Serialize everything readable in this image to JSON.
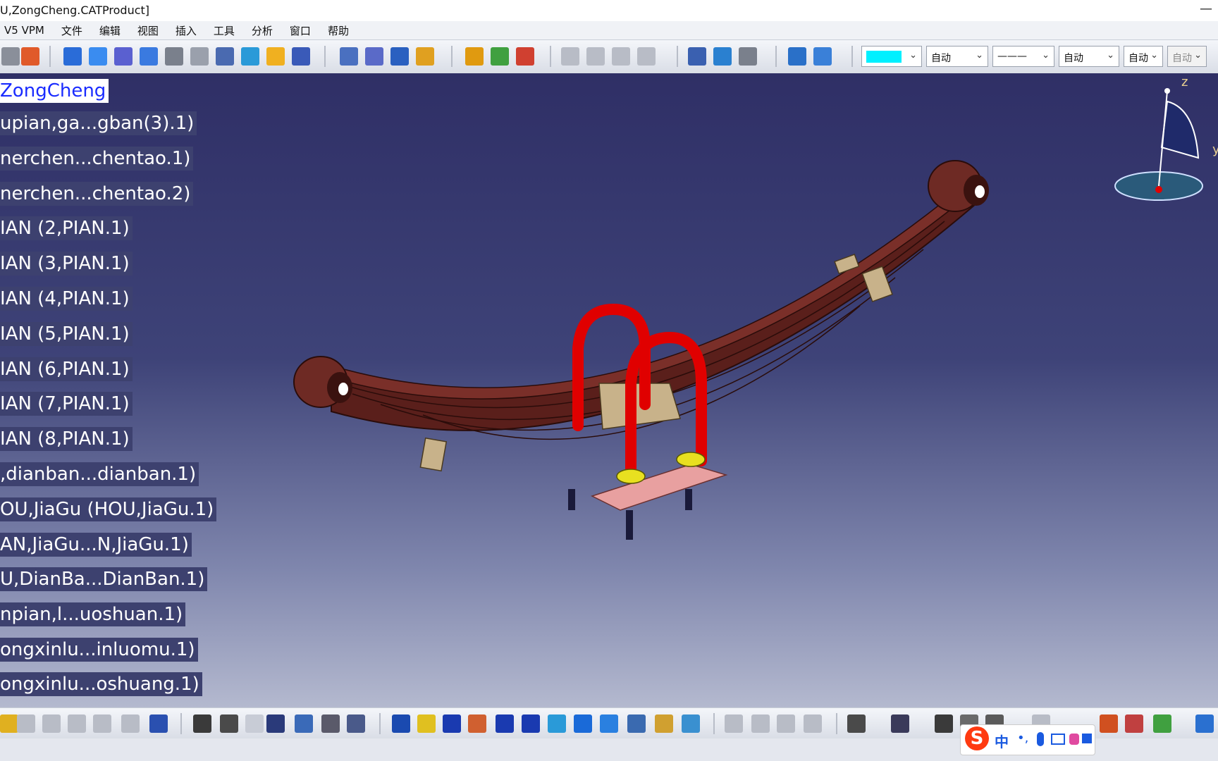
{
  "window": {
    "title": "U,ZongCheng.CATProduct]",
    "minimize_glyph": "—"
  },
  "menu": {
    "items": [
      "V5 VPM",
      "文件",
      "编辑",
      "视图",
      "插入",
      "工具",
      "分析",
      "窗口",
      "帮助"
    ]
  },
  "toolbar": {
    "color_swatch": "#00f0ff",
    "combos": [
      "自动",
      "自动",
      "自动",
      "自动"
    ],
    "line_style_combo": "———"
  },
  "tree": {
    "root": "ZongCheng",
    "items": [
      "upian,ga...gban(3).1)",
      "nerchen...chentao.1)",
      "nerchen...chentao.2)",
      "IAN (2,PIAN.1)",
      "IAN (3,PIAN.1)",
      "IAN (4,PIAN.1)",
      "IAN (5,PIAN.1)",
      "IAN (6,PIAN.1)",
      "IAN (7,PIAN.1)",
      "IAN (8,PIAN.1)",
      ",dianban...dianban.1)",
      "OU,JiaGu (HOU,JiaGu.1)",
      "AN,JiaGu...N,JiaGu.1)",
      "U,DianBa...DianBan.1)",
      "npian,l...uoshuan.1)",
      "ongxinlu...inluomu.1)",
      "ongxinlu...oshuang.1)"
    ]
  },
  "compass": {
    "z_label": "z",
    "y_label": "y"
  },
  "ime": {
    "logo": "S",
    "mode": "中",
    "punct": "•,"
  },
  "colors": {
    "spring_leaf": "#6e2a24",
    "u_bolt": "#e00000",
    "clamp": "#c8b28a",
    "plate": "#e8a0a0"
  }
}
